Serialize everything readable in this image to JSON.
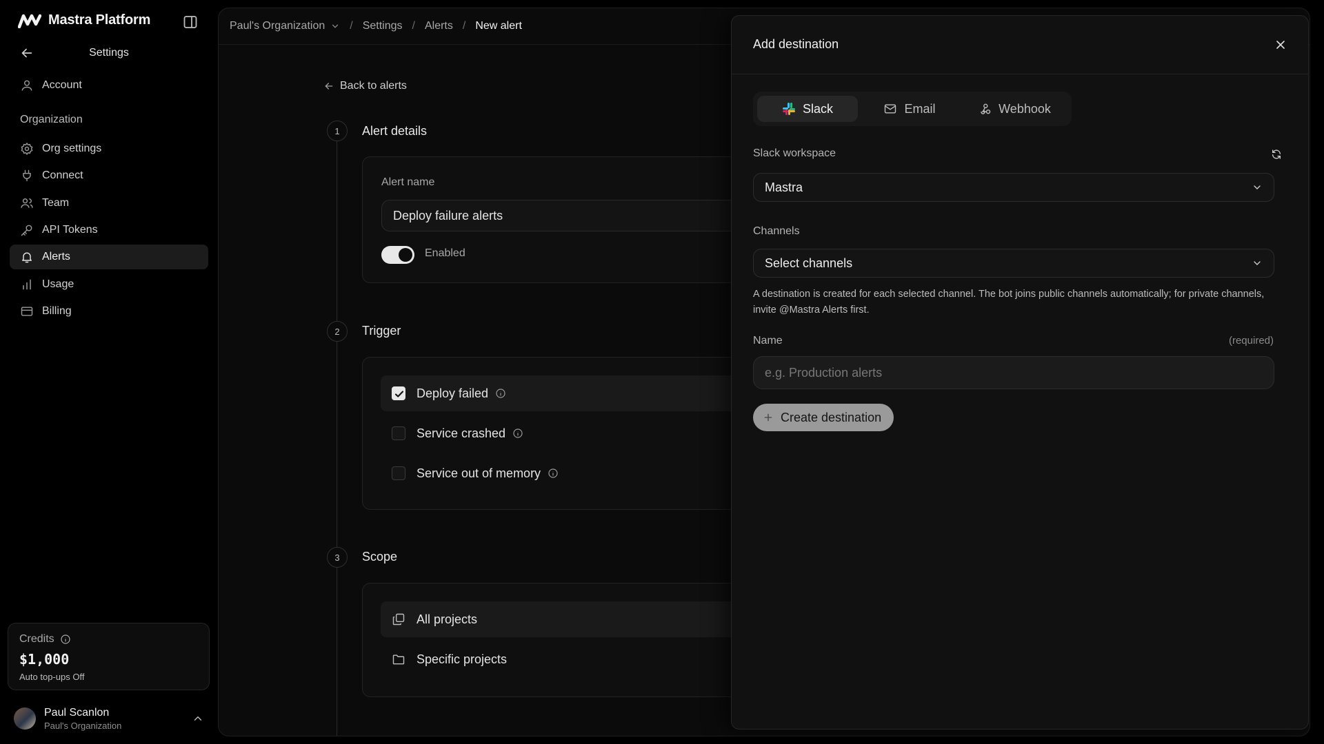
{
  "brand": {
    "name": "Mastra Platform"
  },
  "sidebar": {
    "header_title": "Settings",
    "account_label": "Account",
    "section_label": "Organization",
    "items": [
      {
        "label": "Org settings",
        "icon": "gear-icon"
      },
      {
        "label": "Connect",
        "icon": "plug-icon"
      },
      {
        "label": "Team",
        "icon": "users-icon"
      },
      {
        "label": "API Tokens",
        "icon": "key-icon"
      },
      {
        "label": "Alerts",
        "icon": "bell-icon",
        "active": true
      },
      {
        "label": "Usage",
        "icon": "bar-chart-icon"
      },
      {
        "label": "Billing",
        "icon": "credit-card-icon"
      }
    ],
    "credits": {
      "label": "Credits",
      "amount": "$1,000",
      "sub": "Auto top-ups Off"
    },
    "user": {
      "name": "Paul Scanlon",
      "org": "Paul's Organization"
    }
  },
  "breadcrumb": {
    "org": "Paul's Organization",
    "items": [
      "Settings",
      "Alerts"
    ],
    "current": "New alert"
  },
  "form": {
    "back_label": "Back to alerts",
    "steps": [
      {
        "number": "1",
        "title": "Alert details"
      },
      {
        "number": "2",
        "title": "Trigger"
      },
      {
        "number": "3",
        "title": "Scope"
      }
    ],
    "alert_name_label": "Alert name",
    "alert_name_value": "Deploy failure alerts",
    "enabled_label": "Enabled",
    "enabled": true,
    "triggers": [
      {
        "label": "Deploy failed",
        "checked": true
      },
      {
        "label": "Service crashed",
        "checked": false
      },
      {
        "label": "Service out of memory",
        "checked": false
      }
    ],
    "scope": [
      {
        "label": "All projects",
        "selected": true
      },
      {
        "label": "Specific projects",
        "selected": false
      }
    ]
  },
  "drawer": {
    "title": "Add destination",
    "tabs": [
      {
        "label": "Slack",
        "icon": "slack-icon",
        "active": true
      },
      {
        "label": "Email",
        "icon": "mail-icon",
        "active": false
      },
      {
        "label": "Webhook",
        "icon": "webhook-icon",
        "active": false
      }
    ],
    "workspace_label": "Slack workspace",
    "workspace_value": "Mastra",
    "channels_label": "Channels",
    "channels_placeholder": "Select channels",
    "help_text": "A destination is created for each selected channel. The bot joins public channels automatically; for private channels, invite @Mastra Alerts first.",
    "name_label": "Name",
    "name_required": "(required)",
    "name_placeholder": "e.g. Production alerts",
    "create_label": "Create destination"
  }
}
